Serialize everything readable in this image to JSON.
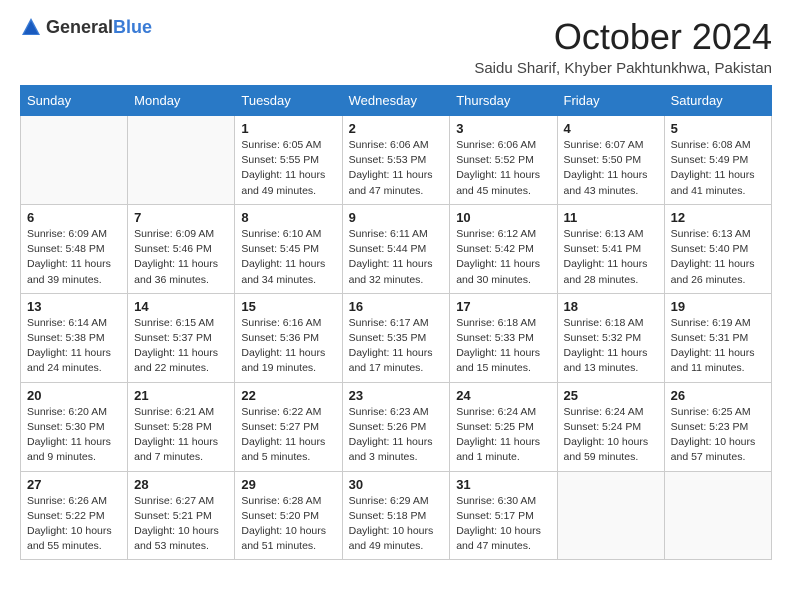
{
  "header": {
    "logo_general": "General",
    "logo_blue": "Blue",
    "month_title": "October 2024",
    "location": "Saidu Sharif, Khyber Pakhtunkhwa, Pakistan"
  },
  "weekdays": [
    "Sunday",
    "Monday",
    "Tuesday",
    "Wednesday",
    "Thursday",
    "Friday",
    "Saturday"
  ],
  "weeks": [
    [
      {
        "day": "",
        "info": ""
      },
      {
        "day": "",
        "info": ""
      },
      {
        "day": "1",
        "info": "Sunrise: 6:05 AM\nSunset: 5:55 PM\nDaylight: 11 hours and 49 minutes."
      },
      {
        "day": "2",
        "info": "Sunrise: 6:06 AM\nSunset: 5:53 PM\nDaylight: 11 hours and 47 minutes."
      },
      {
        "day": "3",
        "info": "Sunrise: 6:06 AM\nSunset: 5:52 PM\nDaylight: 11 hours and 45 minutes."
      },
      {
        "day": "4",
        "info": "Sunrise: 6:07 AM\nSunset: 5:50 PM\nDaylight: 11 hours and 43 minutes."
      },
      {
        "day": "5",
        "info": "Sunrise: 6:08 AM\nSunset: 5:49 PM\nDaylight: 11 hours and 41 minutes."
      }
    ],
    [
      {
        "day": "6",
        "info": "Sunrise: 6:09 AM\nSunset: 5:48 PM\nDaylight: 11 hours and 39 minutes."
      },
      {
        "day": "7",
        "info": "Sunrise: 6:09 AM\nSunset: 5:46 PM\nDaylight: 11 hours and 36 minutes."
      },
      {
        "day": "8",
        "info": "Sunrise: 6:10 AM\nSunset: 5:45 PM\nDaylight: 11 hours and 34 minutes."
      },
      {
        "day": "9",
        "info": "Sunrise: 6:11 AM\nSunset: 5:44 PM\nDaylight: 11 hours and 32 minutes."
      },
      {
        "day": "10",
        "info": "Sunrise: 6:12 AM\nSunset: 5:42 PM\nDaylight: 11 hours and 30 minutes."
      },
      {
        "day": "11",
        "info": "Sunrise: 6:13 AM\nSunset: 5:41 PM\nDaylight: 11 hours and 28 minutes."
      },
      {
        "day": "12",
        "info": "Sunrise: 6:13 AM\nSunset: 5:40 PM\nDaylight: 11 hours and 26 minutes."
      }
    ],
    [
      {
        "day": "13",
        "info": "Sunrise: 6:14 AM\nSunset: 5:38 PM\nDaylight: 11 hours and 24 minutes."
      },
      {
        "day": "14",
        "info": "Sunrise: 6:15 AM\nSunset: 5:37 PM\nDaylight: 11 hours and 22 minutes."
      },
      {
        "day": "15",
        "info": "Sunrise: 6:16 AM\nSunset: 5:36 PM\nDaylight: 11 hours and 19 minutes."
      },
      {
        "day": "16",
        "info": "Sunrise: 6:17 AM\nSunset: 5:35 PM\nDaylight: 11 hours and 17 minutes."
      },
      {
        "day": "17",
        "info": "Sunrise: 6:18 AM\nSunset: 5:33 PM\nDaylight: 11 hours and 15 minutes."
      },
      {
        "day": "18",
        "info": "Sunrise: 6:18 AM\nSunset: 5:32 PM\nDaylight: 11 hours and 13 minutes."
      },
      {
        "day": "19",
        "info": "Sunrise: 6:19 AM\nSunset: 5:31 PM\nDaylight: 11 hours and 11 minutes."
      }
    ],
    [
      {
        "day": "20",
        "info": "Sunrise: 6:20 AM\nSunset: 5:30 PM\nDaylight: 11 hours and 9 minutes."
      },
      {
        "day": "21",
        "info": "Sunrise: 6:21 AM\nSunset: 5:28 PM\nDaylight: 11 hours and 7 minutes."
      },
      {
        "day": "22",
        "info": "Sunrise: 6:22 AM\nSunset: 5:27 PM\nDaylight: 11 hours and 5 minutes."
      },
      {
        "day": "23",
        "info": "Sunrise: 6:23 AM\nSunset: 5:26 PM\nDaylight: 11 hours and 3 minutes."
      },
      {
        "day": "24",
        "info": "Sunrise: 6:24 AM\nSunset: 5:25 PM\nDaylight: 11 hours and 1 minute."
      },
      {
        "day": "25",
        "info": "Sunrise: 6:24 AM\nSunset: 5:24 PM\nDaylight: 10 hours and 59 minutes."
      },
      {
        "day": "26",
        "info": "Sunrise: 6:25 AM\nSunset: 5:23 PM\nDaylight: 10 hours and 57 minutes."
      }
    ],
    [
      {
        "day": "27",
        "info": "Sunrise: 6:26 AM\nSunset: 5:22 PM\nDaylight: 10 hours and 55 minutes."
      },
      {
        "day": "28",
        "info": "Sunrise: 6:27 AM\nSunset: 5:21 PM\nDaylight: 10 hours and 53 minutes."
      },
      {
        "day": "29",
        "info": "Sunrise: 6:28 AM\nSunset: 5:20 PM\nDaylight: 10 hours and 51 minutes."
      },
      {
        "day": "30",
        "info": "Sunrise: 6:29 AM\nSunset: 5:18 PM\nDaylight: 10 hours and 49 minutes."
      },
      {
        "day": "31",
        "info": "Sunrise: 6:30 AM\nSunset: 5:17 PM\nDaylight: 10 hours and 47 minutes."
      },
      {
        "day": "",
        "info": ""
      },
      {
        "day": "",
        "info": ""
      }
    ]
  ]
}
